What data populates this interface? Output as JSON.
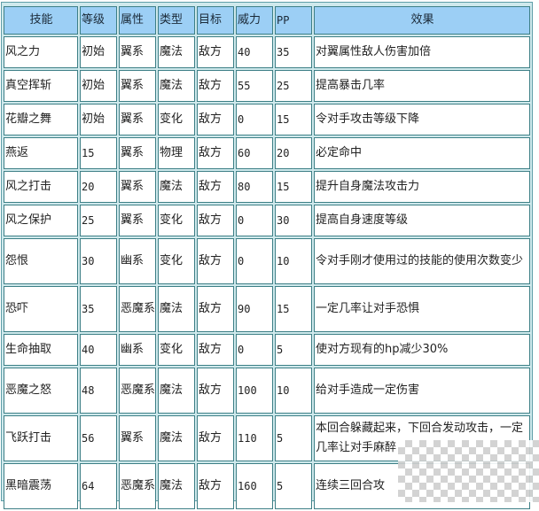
{
  "table": {
    "headers": [
      "技能",
      "等级",
      "属性",
      "类型",
      "目标",
      "威力",
      "PP",
      "效果"
    ],
    "rows": [
      {
        "skill": "风之力",
        "level": "初始",
        "attribute": "翼系",
        "type": "魔法",
        "target": "敌方",
        "power": "40",
        "pp": "35",
        "effect": "对翼属性敌人伤害加倍"
      },
      {
        "skill": "真空挥斩",
        "level": "初始",
        "attribute": "翼系",
        "type": "魔法",
        "target": "敌方",
        "power": "55",
        "pp": "25",
        "effect": "提高暴击几率"
      },
      {
        "skill": "花瓣之舞",
        "level": "初始",
        "attribute": "翼系",
        "type": "变化",
        "target": "敌方",
        "power": "0",
        "pp": "15",
        "effect": "令对手攻击等级下降"
      },
      {
        "skill": "燕返",
        "level": "15",
        "attribute": "翼系",
        "type": "物理",
        "target": "敌方",
        "power": "60",
        "pp": "20",
        "effect": "必定命中"
      },
      {
        "skill": "风之打击",
        "level": "20",
        "attribute": "翼系",
        "type": "魔法",
        "target": "敌方",
        "power": "80",
        "pp": "15",
        "effect": "提升自身魔法攻击力"
      },
      {
        "skill": "风之保护",
        "level": "25",
        "attribute": "翼系",
        "type": "变化",
        "target": "敌方",
        "power": "0",
        "pp": "30",
        "effect": "提高自身速度等级"
      },
      {
        "skill": "怨恨",
        "level": "30",
        "attribute": "幽系",
        "type": "变化",
        "target": "敌方",
        "power": "0",
        "pp": "10",
        "effect": "令对手刚才使用过的技能的使用次数变少"
      },
      {
        "skill": "恐吓",
        "level": "35",
        "attribute": "恶魔系",
        "type": "魔法",
        "target": "敌方",
        "power": "90",
        "pp": "15",
        "effect": "一定几率让对手恐惧"
      },
      {
        "skill": "生命抽取",
        "level": "40",
        "attribute": "幽系",
        "type": "变化",
        "target": "敌方",
        "power": "0",
        "pp": "5",
        "effect": "使对方现有的hp减少30%"
      },
      {
        "skill": "恶魔之怒",
        "level": "48",
        "attribute": "恶魔系",
        "type": "魔法",
        "target": "敌方",
        "power": "100",
        "pp": "10",
        "effect": "给对手造成一定伤害"
      },
      {
        "skill": "飞跃打击",
        "level": "56",
        "attribute": "翼系",
        "type": "魔法",
        "target": "敌方",
        "power": "110",
        "pp": "5",
        "effect": "本回合躲藏起来，下回合发动攻击，一定几率让对手麻醉"
      },
      {
        "skill": "黑暗震荡",
        "level": "64",
        "attribute": "恶魔系",
        "type": "魔法",
        "target": "敌方",
        "power": "160",
        "pp": "5",
        "effect": "连续三回合攻"
      }
    ]
  },
  "colors": {
    "header_bg": "#9ccff5",
    "border": "#3d7f86",
    "frame_bg": "#cfe9ec"
  }
}
